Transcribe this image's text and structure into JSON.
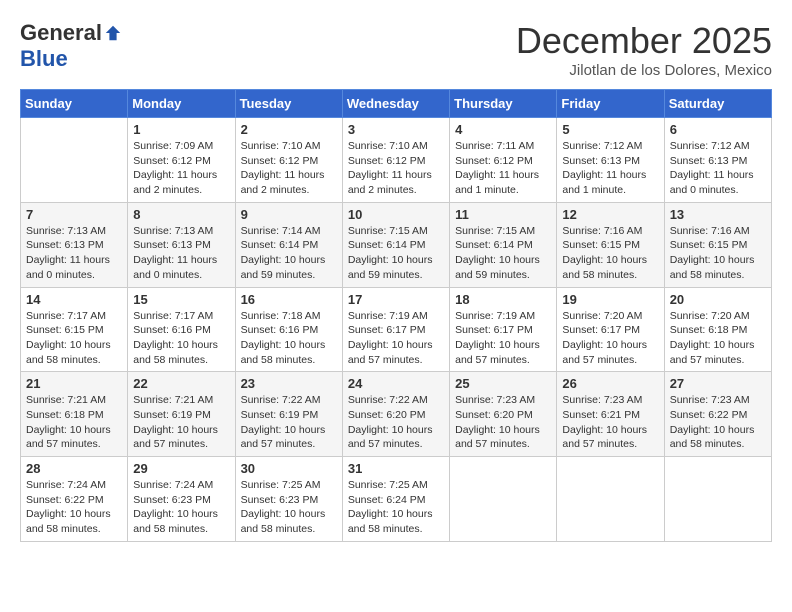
{
  "header": {
    "logo_general": "General",
    "logo_blue": "Blue",
    "month_title": "December 2025",
    "subtitle": "Jilotlan de los Dolores, Mexico"
  },
  "days_of_week": [
    "Sunday",
    "Monday",
    "Tuesday",
    "Wednesday",
    "Thursday",
    "Friday",
    "Saturday"
  ],
  "weeks": [
    [
      {
        "day": "",
        "info": ""
      },
      {
        "day": "1",
        "info": "Sunrise: 7:09 AM\nSunset: 6:12 PM\nDaylight: 11 hours\nand 2 minutes."
      },
      {
        "day": "2",
        "info": "Sunrise: 7:10 AM\nSunset: 6:12 PM\nDaylight: 11 hours\nand 2 minutes."
      },
      {
        "day": "3",
        "info": "Sunrise: 7:10 AM\nSunset: 6:12 PM\nDaylight: 11 hours\nand 2 minutes."
      },
      {
        "day": "4",
        "info": "Sunrise: 7:11 AM\nSunset: 6:12 PM\nDaylight: 11 hours\nand 1 minute."
      },
      {
        "day": "5",
        "info": "Sunrise: 7:12 AM\nSunset: 6:13 PM\nDaylight: 11 hours\nand 1 minute."
      },
      {
        "day": "6",
        "info": "Sunrise: 7:12 AM\nSunset: 6:13 PM\nDaylight: 11 hours\nand 0 minutes."
      }
    ],
    [
      {
        "day": "7",
        "info": "Sunrise: 7:13 AM\nSunset: 6:13 PM\nDaylight: 11 hours\nand 0 minutes."
      },
      {
        "day": "8",
        "info": "Sunrise: 7:13 AM\nSunset: 6:13 PM\nDaylight: 11 hours\nand 0 minutes."
      },
      {
        "day": "9",
        "info": "Sunrise: 7:14 AM\nSunset: 6:14 PM\nDaylight: 10 hours\nand 59 minutes."
      },
      {
        "day": "10",
        "info": "Sunrise: 7:15 AM\nSunset: 6:14 PM\nDaylight: 10 hours\nand 59 minutes."
      },
      {
        "day": "11",
        "info": "Sunrise: 7:15 AM\nSunset: 6:14 PM\nDaylight: 10 hours\nand 59 minutes."
      },
      {
        "day": "12",
        "info": "Sunrise: 7:16 AM\nSunset: 6:15 PM\nDaylight: 10 hours\nand 58 minutes."
      },
      {
        "day": "13",
        "info": "Sunrise: 7:16 AM\nSunset: 6:15 PM\nDaylight: 10 hours\nand 58 minutes."
      }
    ],
    [
      {
        "day": "14",
        "info": "Sunrise: 7:17 AM\nSunset: 6:15 PM\nDaylight: 10 hours\nand 58 minutes."
      },
      {
        "day": "15",
        "info": "Sunrise: 7:17 AM\nSunset: 6:16 PM\nDaylight: 10 hours\nand 58 minutes."
      },
      {
        "day": "16",
        "info": "Sunrise: 7:18 AM\nSunset: 6:16 PM\nDaylight: 10 hours\nand 58 minutes."
      },
      {
        "day": "17",
        "info": "Sunrise: 7:19 AM\nSunset: 6:17 PM\nDaylight: 10 hours\nand 57 minutes."
      },
      {
        "day": "18",
        "info": "Sunrise: 7:19 AM\nSunset: 6:17 PM\nDaylight: 10 hours\nand 57 minutes."
      },
      {
        "day": "19",
        "info": "Sunrise: 7:20 AM\nSunset: 6:17 PM\nDaylight: 10 hours\nand 57 minutes."
      },
      {
        "day": "20",
        "info": "Sunrise: 7:20 AM\nSunset: 6:18 PM\nDaylight: 10 hours\nand 57 minutes."
      }
    ],
    [
      {
        "day": "21",
        "info": "Sunrise: 7:21 AM\nSunset: 6:18 PM\nDaylight: 10 hours\nand 57 minutes."
      },
      {
        "day": "22",
        "info": "Sunrise: 7:21 AM\nSunset: 6:19 PM\nDaylight: 10 hours\nand 57 minutes."
      },
      {
        "day": "23",
        "info": "Sunrise: 7:22 AM\nSunset: 6:19 PM\nDaylight: 10 hours\nand 57 minutes."
      },
      {
        "day": "24",
        "info": "Sunrise: 7:22 AM\nSunset: 6:20 PM\nDaylight: 10 hours\nand 57 minutes."
      },
      {
        "day": "25",
        "info": "Sunrise: 7:23 AM\nSunset: 6:20 PM\nDaylight: 10 hours\nand 57 minutes."
      },
      {
        "day": "26",
        "info": "Sunrise: 7:23 AM\nSunset: 6:21 PM\nDaylight: 10 hours\nand 57 minutes."
      },
      {
        "day": "27",
        "info": "Sunrise: 7:23 AM\nSunset: 6:22 PM\nDaylight: 10 hours\nand 58 minutes."
      }
    ],
    [
      {
        "day": "28",
        "info": "Sunrise: 7:24 AM\nSunset: 6:22 PM\nDaylight: 10 hours\nand 58 minutes."
      },
      {
        "day": "29",
        "info": "Sunrise: 7:24 AM\nSunset: 6:23 PM\nDaylight: 10 hours\nand 58 minutes."
      },
      {
        "day": "30",
        "info": "Sunrise: 7:25 AM\nSunset: 6:23 PM\nDaylight: 10 hours\nand 58 minutes."
      },
      {
        "day": "31",
        "info": "Sunrise: 7:25 AM\nSunset: 6:24 PM\nDaylight: 10 hours\nand 58 minutes."
      },
      {
        "day": "",
        "info": ""
      },
      {
        "day": "",
        "info": ""
      },
      {
        "day": "",
        "info": ""
      }
    ]
  ]
}
